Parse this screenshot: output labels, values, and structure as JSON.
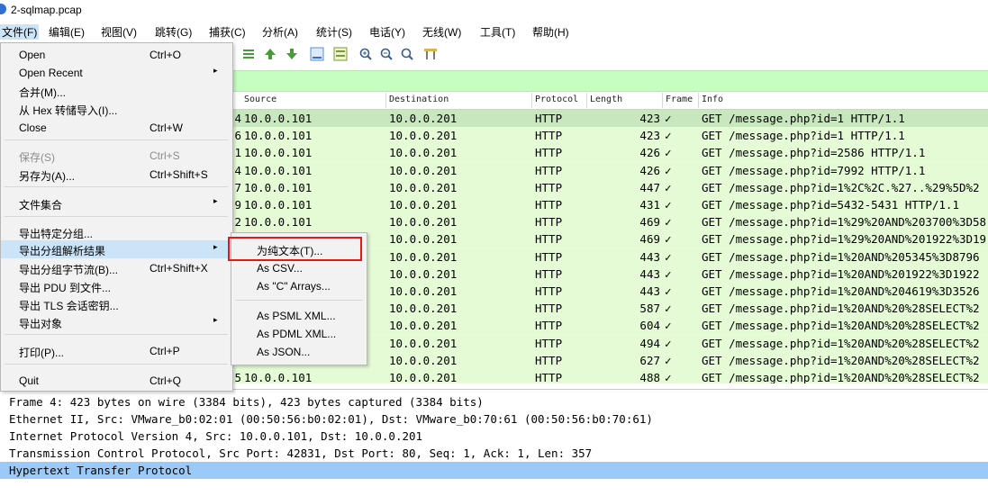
{
  "window": {
    "title": "2-sqlmap.pcap"
  },
  "menubar": [
    "文件(F)",
    "编辑(E)",
    "视图(V)",
    "跳转(G)",
    "捕获(C)",
    "分析(A)",
    "统计(S)",
    "电话(Y)",
    "无线(W)",
    "工具(T)",
    "帮助(H)"
  ],
  "toolbar_icons": [
    "jump-first-icon",
    "go-first-icon",
    "go-last-icon",
    "autoscroll-icon",
    "colorize-icon",
    "zoom-in-icon",
    "zoom-out-icon",
    "zoom-normal-icon",
    "resize-columns-icon"
  ],
  "columns": {
    "source": "Source",
    "destination": "Destination",
    "protocol": "Protocol",
    "length": "Length",
    "frame": "Frame",
    "info": "Info"
  },
  "packets": [
    {
      "no": "4",
      "src": "10.0.0.101",
      "dst": "10.0.0.201",
      "proto": "HTTP",
      "len": "423",
      "chk": "✓",
      "info": "GET /message.php?id=1 HTTP/1.1"
    },
    {
      "no": "6",
      "src": "10.0.0.101",
      "dst": "10.0.0.201",
      "proto": "HTTP",
      "len": "423",
      "chk": "✓",
      "info": "GET /message.php?id=1 HTTP/1.1"
    },
    {
      "no": "1",
      "src": "10.0.0.101",
      "dst": "10.0.0.201",
      "proto": "HTTP",
      "len": "426",
      "chk": "✓",
      "info": "GET /message.php?id=2586 HTTP/1.1"
    },
    {
      "no": "4",
      "src": "10.0.0.101",
      "dst": "10.0.0.201",
      "proto": "HTTP",
      "len": "426",
      "chk": "✓",
      "info": "GET /message.php?id=7992 HTTP/1.1"
    },
    {
      "no": "7",
      "src": "10.0.0.101",
      "dst": "10.0.0.201",
      "proto": "HTTP",
      "len": "447",
      "chk": "✓",
      "info": "GET /message.php?id=1%2C%2C.%27..%29%5D%2"
    },
    {
      "no": "9",
      "src": "10.0.0.101",
      "dst": "10.0.0.201",
      "proto": "HTTP",
      "len": "431",
      "chk": "✓",
      "info": "GET /message.php?id=5432-5431 HTTP/1.1"
    },
    {
      "no": "2",
      "src": "10.0.0.101",
      "dst": "10.0.0.201",
      "proto": "HTTP",
      "len": "469",
      "chk": "✓",
      "info": "GET /message.php?id=1%29%20AND%203700%3D58"
    },
    {
      "no": "",
      "src": "",
      "dst": "10.0.0.201",
      "proto": "HTTP",
      "len": "469",
      "chk": "✓",
      "info": "GET /message.php?id=1%29%20AND%201922%3D19"
    },
    {
      "no": "",
      "src": "",
      "dst": "10.0.0.201",
      "proto": "HTTP",
      "len": "443",
      "chk": "✓",
      "info": "GET /message.php?id=1%20AND%205345%3D8796"
    },
    {
      "no": "",
      "src": "",
      "dst": "10.0.0.201",
      "proto": "HTTP",
      "len": "443",
      "chk": "✓",
      "info": "GET /message.php?id=1%20AND%201922%3D1922"
    },
    {
      "no": "",
      "src": "",
      "dst": "10.0.0.201",
      "proto": "HTTP",
      "len": "443",
      "chk": "✓",
      "info": "GET /message.php?id=1%20AND%204619%3D3526"
    },
    {
      "no": "",
      "src": "",
      "dst": "10.0.0.201",
      "proto": "HTTP",
      "len": "587",
      "chk": "✓",
      "info": "GET /message.php?id=1%20AND%20%28SELECT%2"
    },
    {
      "no": "",
      "src": "",
      "dst": "10.0.0.201",
      "proto": "HTTP",
      "len": "604",
      "chk": "✓",
      "info": "GET /message.php?id=1%20AND%20%28SELECT%2"
    },
    {
      "no": "",
      "src": "",
      "dst": "10.0.0.201",
      "proto": "HTTP",
      "len": "494",
      "chk": "✓",
      "info": "GET /message.php?id=1%20AND%20%28SELECT%2"
    },
    {
      "no": "",
      "src": "",
      "dst": "10.0.0.201",
      "proto": "HTTP",
      "len": "627",
      "chk": "✓",
      "info": "GET /message.php?id=1%20AND%20%28SELECT%2"
    },
    {
      "no": "5",
      "src": "10.0.0.101",
      "dst": "10.0.0.201",
      "proto": "HTTP",
      "len": "488",
      "chk": "✓",
      "info": "GET /message.php?id=1%20AND%20%28SELECT%2"
    }
  ],
  "details": [
    "Frame 4: 423 bytes on wire (3384 bits), 423 bytes captured (3384 bits)",
    "Ethernet II, Src: VMware_b0:02:01 (00:50:56:b0:02:01), Dst: VMware_b0:70:61 (00:50:56:b0:70:61)",
    "Internet Protocol Version 4, Src: 10.0.0.101, Dst: 10.0.0.201",
    "Transmission Control Protocol, Src Port: 42831, Dst Port: 80, Seq: 1, Ack: 1, Len: 357",
    "Hypertext Transfer Protocol"
  ],
  "file_menu": {
    "open": {
      "label": "Open",
      "shortcut": "Ctrl+O"
    },
    "open_recent": {
      "label": "Open Recent"
    },
    "merge": {
      "label": "合并(M)..."
    },
    "import_hex": {
      "label": "从 Hex 转储导入(I)..."
    },
    "close": {
      "label": "Close",
      "shortcut": "Ctrl+W"
    },
    "save": {
      "label": "保存(S)",
      "shortcut": "Ctrl+S"
    },
    "save_as": {
      "label": "另存为(A)...",
      "shortcut": "Ctrl+Shift+S"
    },
    "file_set": {
      "label": "文件集合"
    },
    "export_specified": {
      "label": "导出特定分组..."
    },
    "export_dissections": {
      "label": "导出分组解析结果"
    },
    "export_bytes": {
      "label": "导出分组字节流(B)...",
      "shortcut": "Ctrl+Shift+X"
    },
    "export_pdu": {
      "label": "导出 PDU 到文件..."
    },
    "export_tls": {
      "label": "导出 TLS 会话密钥..."
    },
    "export_objects": {
      "label": "导出对象"
    },
    "print": {
      "label": "打印(P)...",
      "shortcut": "Ctrl+P"
    },
    "quit": {
      "label": "Quit",
      "shortcut": "Ctrl+Q"
    }
  },
  "submenu": [
    "为纯文本(T)...",
    "As CSV...",
    "As \"C\" Arrays...",
    "As PSML XML...",
    "As PDML XML...",
    "As JSON..."
  ]
}
